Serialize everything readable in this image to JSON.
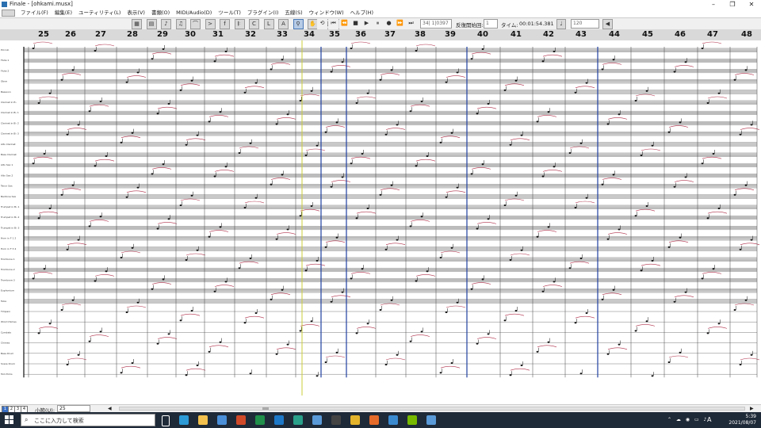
{
  "window": {
    "title": "Finale - [ohkami.musx]",
    "controls": [
      "–",
      "❐",
      "✕"
    ]
  },
  "menu": [
    "ファイル(F)",
    "編集(E)",
    "ユーティリティ(L)",
    "表示(V)",
    "書類(O)",
    "MIDI/Audio(D)",
    "ツール(T)",
    "プラグイン(I)",
    "五線(S)",
    "ウィンドウ(W)",
    "ヘルプ(H)"
  ],
  "toolbar": {
    "measure_field": "34| 1|0397",
    "repeat_label": "反復開始回:",
    "repeat_value": "1",
    "time_label": "タイム:",
    "time_value": "00:01:54.381",
    "tempo_value": "120"
  },
  "ruler": {
    "measures": [
      "25",
      "26",
      "27",
      "28",
      "29",
      "30",
      "31",
      "32",
      "33",
      "34",
      "35",
      "36",
      "37",
      "38",
      "39",
      "40",
      "41",
      "42",
      "43",
      "44",
      "45",
      "46",
      "47",
      "48"
    ]
  },
  "score": {
    "instruments": [
      "Piccolo",
      "Flute 1",
      "Flute 2",
      "Oboe",
      "Bassoon",
      "Clarinet in E♭",
      "Clarinet in B♭ 1",
      "Clarinet in B♭ 2",
      "Clarinet in B♭ 3",
      "Alto Clarinet",
      "Bass Clarinet",
      "Alto Sax 1",
      "Alto Sax 2",
      "Tenor Sax",
      "Baritone Sax",
      "Trumpet in B♭ 1",
      "Trumpet in B♭ 2",
      "Trumpet in B♭ 3",
      "Horn in F 1 2",
      "Horn in F 3 4",
      "Trombone 1",
      "Trombone 2",
      "Trombone 3",
      "Euphonium",
      "Tuba",
      "Timpani",
      "Wind Chimes",
      "Cymbals",
      "Chimes",
      "Bass Drum",
      "Snare Drum",
      "Tom-Toms"
    ]
  },
  "status": {
    "pages": [
      "1",
      "2",
      "3",
      "4"
    ],
    "measure_label": "小節(U):",
    "measure_value": "25"
  },
  "taskbar": {
    "search_placeholder": "ここに入力して検索",
    "time": "5:39",
    "date": "2021/08/07",
    "ime": "A"
  },
  "colors": {
    "slur": "#b0304a",
    "cursor": "#c9cc3a",
    "barline_blue": "#2040a0",
    "taskbar": "#1f2a38"
  }
}
